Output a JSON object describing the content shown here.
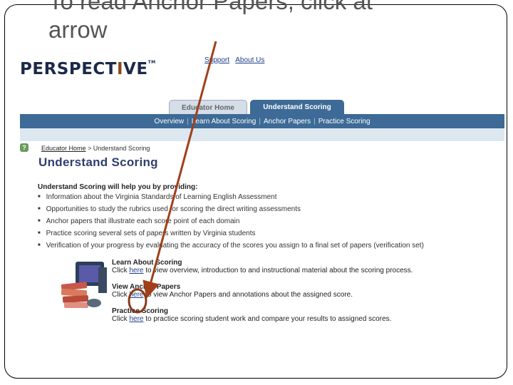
{
  "slide": {
    "title_line1": "To read Anchor Papers, click at",
    "title_line2": "arrow"
  },
  "site": {
    "logo_pre": "PERSPECT",
    "logo_i": "I",
    "logo_post": "VE",
    "logo_tm": "TM",
    "top_links": [
      "Support",
      "About Us"
    ]
  },
  "tabs": [
    {
      "label": "Educator Home",
      "active": false
    },
    {
      "label": "Understand Scoring",
      "active": true
    }
  ],
  "subnav": [
    "Overview",
    "Learn About Scoring",
    "Anchor Papers",
    "Practice Scoring"
  ],
  "subnav_sep": "|",
  "help_icon": "?",
  "breadcrumb": {
    "home": "Educator Home",
    "sep": " > ",
    "current": "Understand Scoring"
  },
  "page_title": "Understand Scoring",
  "intro": "Understand Scoring will help you by providing:",
  "bullets": [
    "Information about the Virginia Standards of Learning English Assessment",
    "Opportunities to study the rubrics used for scoring the direct writing assessments",
    "Anchor papers that illustrate each score point of each domain",
    "Practice scoring several sets of papers written by Virginia students",
    "Verification of your progress by evaluating the accuracy of the scores you assign to a final set of papers (verification set)"
  ],
  "sections": [
    {
      "heading": "Learn About Scoring",
      "pre": "Click ",
      "link": "here",
      "post": " to view overview, introduction to and instructional material about the scoring process."
    },
    {
      "heading": "View Anchor Papers",
      "pre": "Click ",
      "link": "here",
      "post": " to view Anchor Papers and annotations about the assigned score."
    },
    {
      "heading": "Practice Scoring",
      "pre": "Click ",
      "link": "here",
      "post": " to practice scoring student work and compare your results to assigned scores."
    }
  ],
  "annotation": {
    "arrow_color": "#a0401a",
    "circle_color": "#8a3a1a"
  }
}
